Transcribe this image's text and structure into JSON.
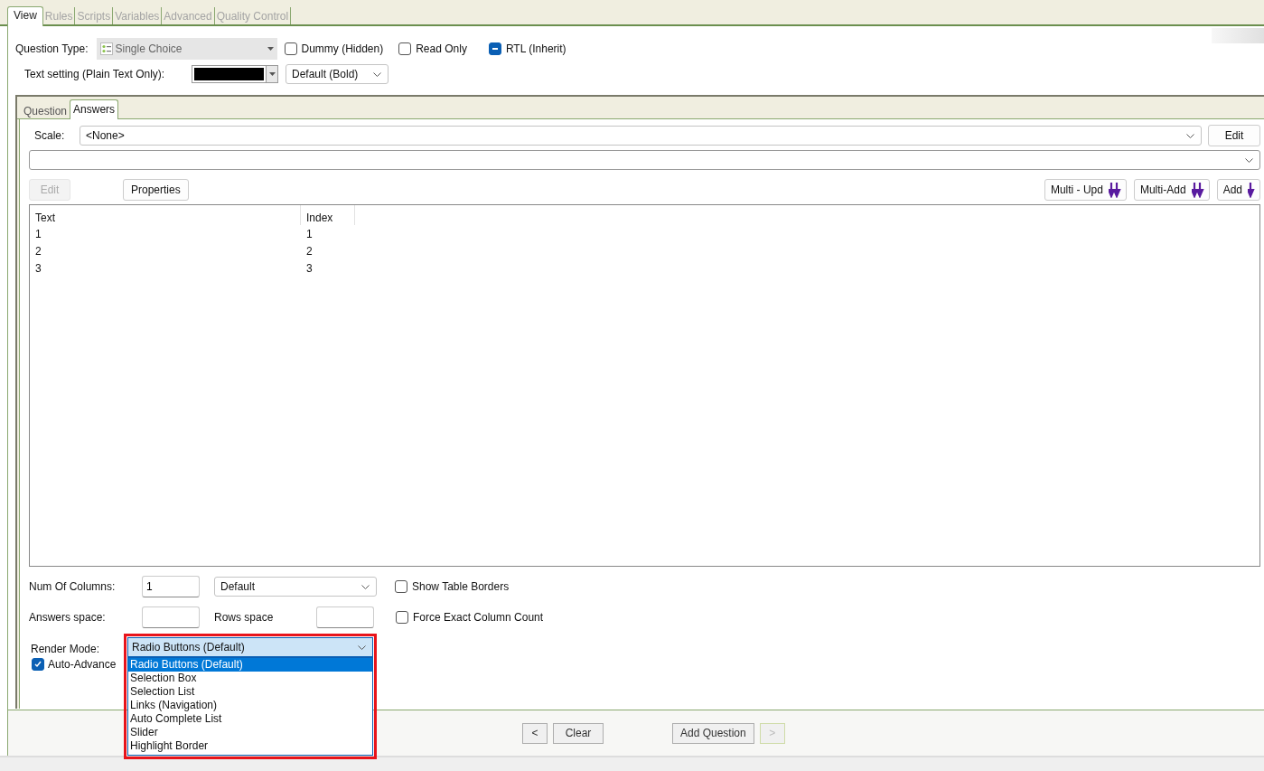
{
  "main_tabs": [
    {
      "label": "View",
      "selected": true,
      "disabled": false
    },
    {
      "label": "Rules",
      "selected": false,
      "disabled": true
    },
    {
      "label": "Scripts",
      "selected": false,
      "disabled": true
    },
    {
      "label": "Variables",
      "selected": false,
      "disabled": true
    },
    {
      "label": "Advanced",
      "selected": false,
      "disabled": true
    },
    {
      "label": "Quality Control",
      "selected": false,
      "disabled": true
    }
  ],
  "question_type": {
    "label": "Question Type:",
    "value": "Single Choice",
    "disabled": true
  },
  "top_checkboxes": [
    {
      "label": "Dummy (Hidden)",
      "checked": false,
      "mixed": false
    },
    {
      "label": "Read Only",
      "checked": false,
      "mixed": false
    },
    {
      "label": "RTL (Inherit)",
      "checked": true,
      "mixed": true
    }
  ],
  "text_setting": {
    "label": "Text setting (Plain Text Only):",
    "color": "#000000",
    "font": "Default (Bold)"
  },
  "inner_tabs": [
    {
      "label": "Question",
      "selected": false
    },
    {
      "label": "Answers",
      "selected": true
    }
  ],
  "scale": {
    "label": "Scale:",
    "value": "<None>",
    "button": "Edit"
  },
  "toolbar_left": [
    {
      "label": "Edit",
      "disabled": true
    },
    {
      "label": "Properties",
      "disabled": false
    }
  ],
  "toolbar_right": [
    {
      "label": "Multi - Upd",
      "kind": "double"
    },
    {
      "label": "Multi-Add",
      "kind": "double"
    },
    {
      "label": "Add",
      "kind": "single"
    }
  ],
  "table": {
    "columns": [
      "Text",
      "Index"
    ],
    "rows": [
      [
        "1",
        "1"
      ],
      [
        "2",
        "2"
      ],
      [
        "3",
        "3"
      ]
    ]
  },
  "num_columns": {
    "label": "Num Of Columns:",
    "value": "1",
    "layout": "Default",
    "checkbox": {
      "label": "Show Table Borders",
      "checked": false
    }
  },
  "answers_space": {
    "label": "Answers space:",
    "rows_label": "Rows space",
    "checkbox": {
      "label": "Force Exact Column Count",
      "checked": false
    }
  },
  "render_mode": {
    "label": "Render Mode:",
    "value": "Radio Buttons (Default)",
    "expanded": true,
    "highlighted": true,
    "options": [
      {
        "label": "Radio Buttons (Default)",
        "selected": true
      },
      {
        "label": "Selection Box",
        "selected": false
      },
      {
        "label": "Selection List",
        "selected": false
      },
      {
        "label": "Links (Navigation)",
        "selected": false
      },
      {
        "label": "Auto Complete List",
        "selected": false
      },
      {
        "label": "Slider",
        "selected": false
      },
      {
        "label": "Highlight Border",
        "selected": false
      }
    ]
  },
  "auto_advance": {
    "label": "Auto-Advance",
    "checked": true
  },
  "footer_buttons": [
    {
      "label": "<",
      "disabled": false
    },
    {
      "label": "Clear",
      "disabled": false
    },
    {
      "label": "Add Question",
      "disabled": false
    },
    {
      "label": ">",
      "disabled": true
    }
  ]
}
